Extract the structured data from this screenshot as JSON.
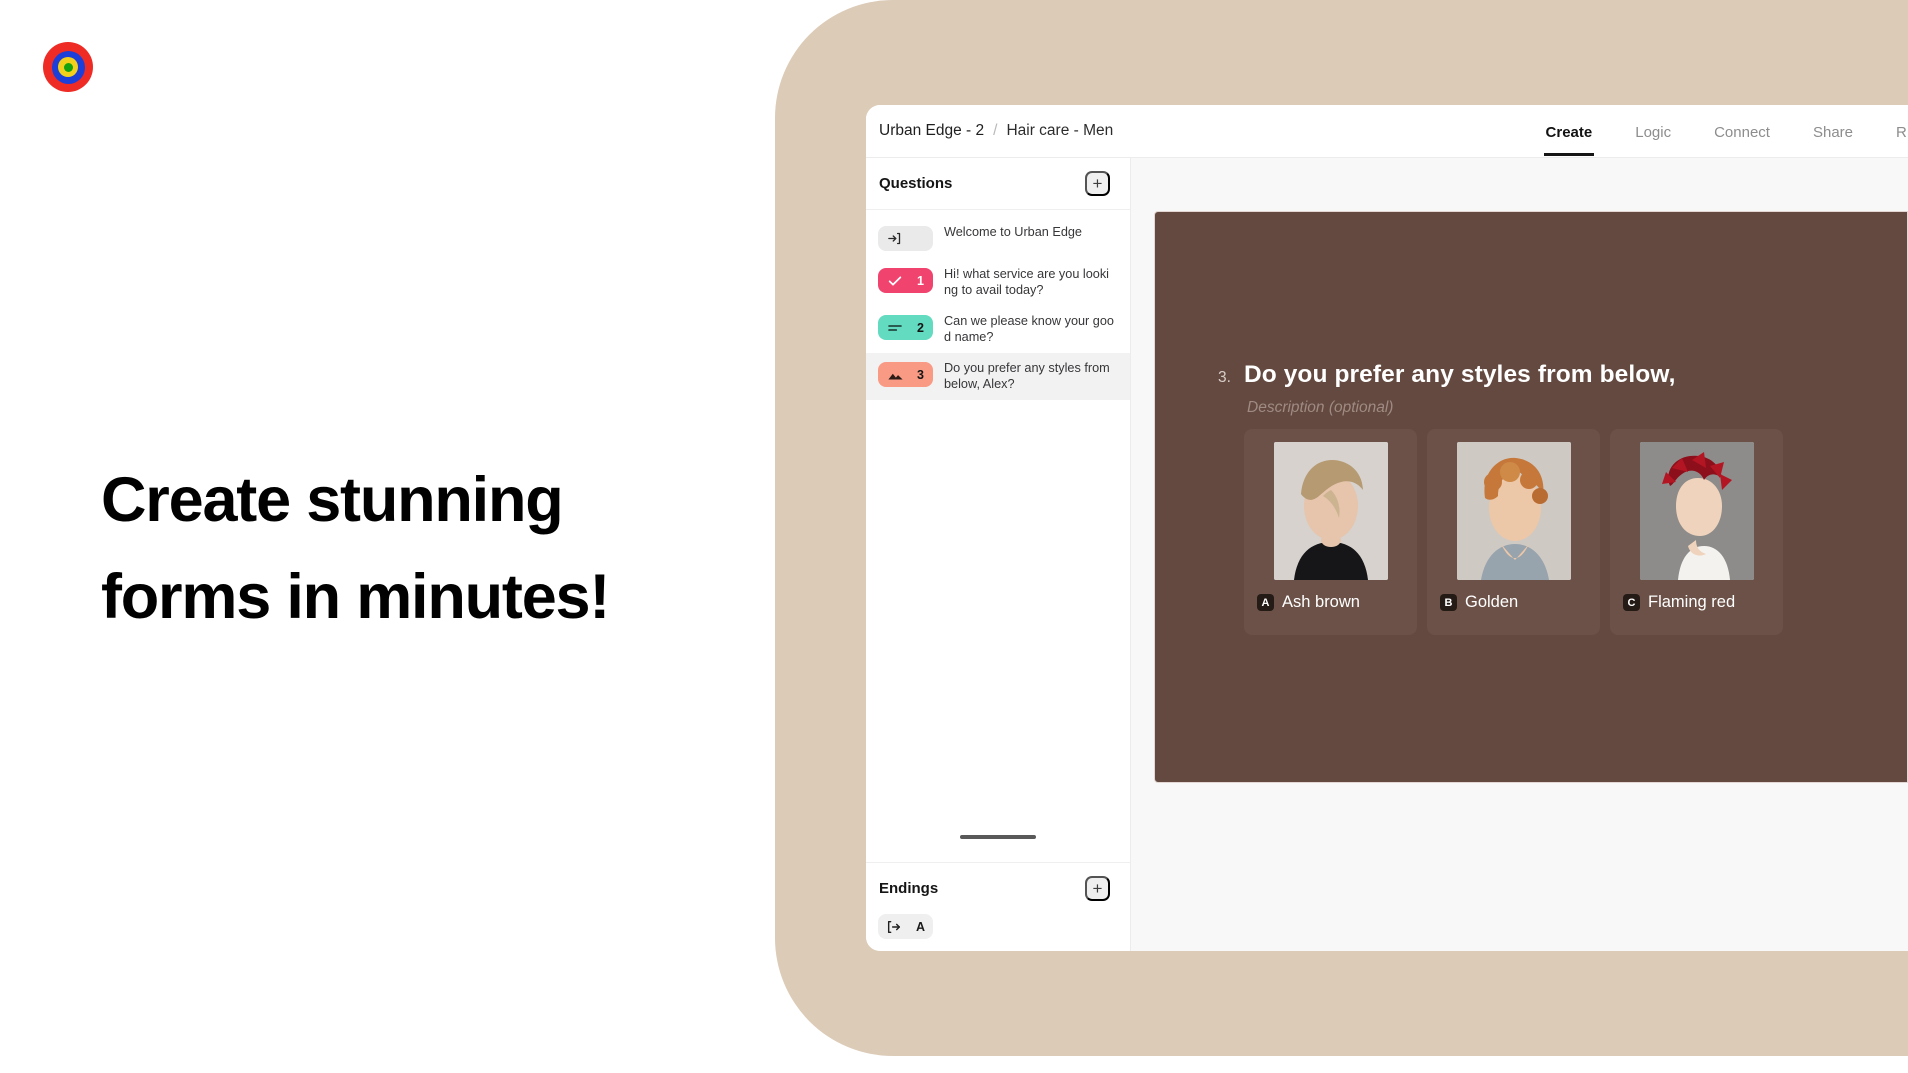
{
  "brand": {
    "logo_name": "target-logo",
    "colors": {
      "ring_outer": "#ee2b24",
      "ring_mid": "#1b3fd8",
      "ring_inner": "#f2d01c",
      "core": "#16a10e"
    }
  },
  "marketing": {
    "headline_line1": "Create stunning",
    "headline_line2": "forms in minutes!"
  },
  "panel": {
    "background_color": "#dbcbb7"
  },
  "app": {
    "breadcrumb": {
      "root": "Urban Edge - 2",
      "separator": "/",
      "leaf": "Hair care - Men"
    },
    "tabs": [
      {
        "label": "Create",
        "active": true
      },
      {
        "label": "Logic",
        "active": false
      },
      {
        "label": "Connect",
        "active": false
      },
      {
        "label": "Share",
        "active": false
      },
      {
        "label": "R",
        "active": false,
        "clipped": true
      }
    ],
    "sidebar": {
      "questions_title": "Questions",
      "add_question_label": "+",
      "questions": [
        {
          "badge_type": "welcome",
          "number": "",
          "text": "Welcome to Urban Edge",
          "selected": false,
          "badge_color": "#eaeaea",
          "icon": "sign-in-icon"
        },
        {
          "badge_type": "multiple-choice",
          "number": "1",
          "text": "Hi! what service are you looking to avail today?",
          "selected": false,
          "badge_color": "#f0436e",
          "icon": "check-icon"
        },
        {
          "badge_type": "short-text",
          "number": "2",
          "text": "Can we please know your good name?",
          "selected": false,
          "badge_color": "#63dbc0",
          "icon": "text-lines-icon"
        },
        {
          "badge_type": "picture-choice",
          "number": "3",
          "text": "Do you prefer any styles from below, Alex?",
          "selected": true,
          "badge_color": "#f99a85",
          "icon": "image-icon"
        }
      ],
      "endings_title": "Endings",
      "add_ending_label": "+",
      "endings": [
        {
          "letter": "A",
          "icon": "exit-icon"
        }
      ]
    },
    "canvas": {
      "form_background": "#63493f",
      "question_index": "3.",
      "question_title": "Do you prefer any styles from below,",
      "description_placeholder": "Description (optional)",
      "options": [
        {
          "key": "A",
          "label": "Ash brown",
          "image_name": "model-ash-brown-photo"
        },
        {
          "key": "B",
          "label": "Golden",
          "image_name": "model-golden-photo"
        },
        {
          "key": "C",
          "label": "Flaming red",
          "image_name": "model-flaming-red-photo"
        }
      ]
    }
  }
}
